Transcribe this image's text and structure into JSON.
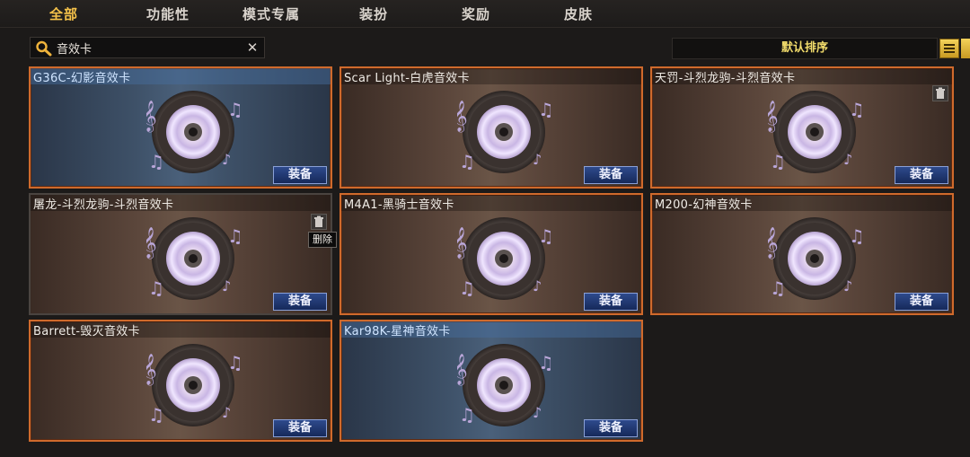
{
  "tabs": [
    {
      "label": "全部"
    },
    {
      "label": "功能性"
    },
    {
      "label": "模式专属"
    },
    {
      "label": "装扮"
    },
    {
      "label": "奖励"
    },
    {
      "label": "皮肤"
    }
  ],
  "active_tab": "全部",
  "search": {
    "value": "音效卡",
    "clear_icon": "close-icon"
  },
  "sort": {
    "label": "默认排序"
  },
  "colors": {
    "accent": "#f5c24a",
    "card_border": "#cf6a2c",
    "equip_button": "#2e4a8c"
  },
  "equip_label": "装备",
  "tooltip": "删除",
  "cards": [
    {
      "title": "G36C-幻影音效卡"
    },
    {
      "title": "Scar Light-白虎音效卡"
    },
    {
      "title": "天罚-斗烈龙驹-斗烈音效卡"
    },
    {
      "title": "屠龙-斗烈龙驹-斗烈音效卡"
    },
    {
      "title": "M4A1-黑骑士音效卡"
    },
    {
      "title": "M200-幻神音效卡"
    },
    {
      "title": "Barrett-毁灭音效卡"
    },
    {
      "title": "Kar98K-星神音效卡"
    }
  ]
}
